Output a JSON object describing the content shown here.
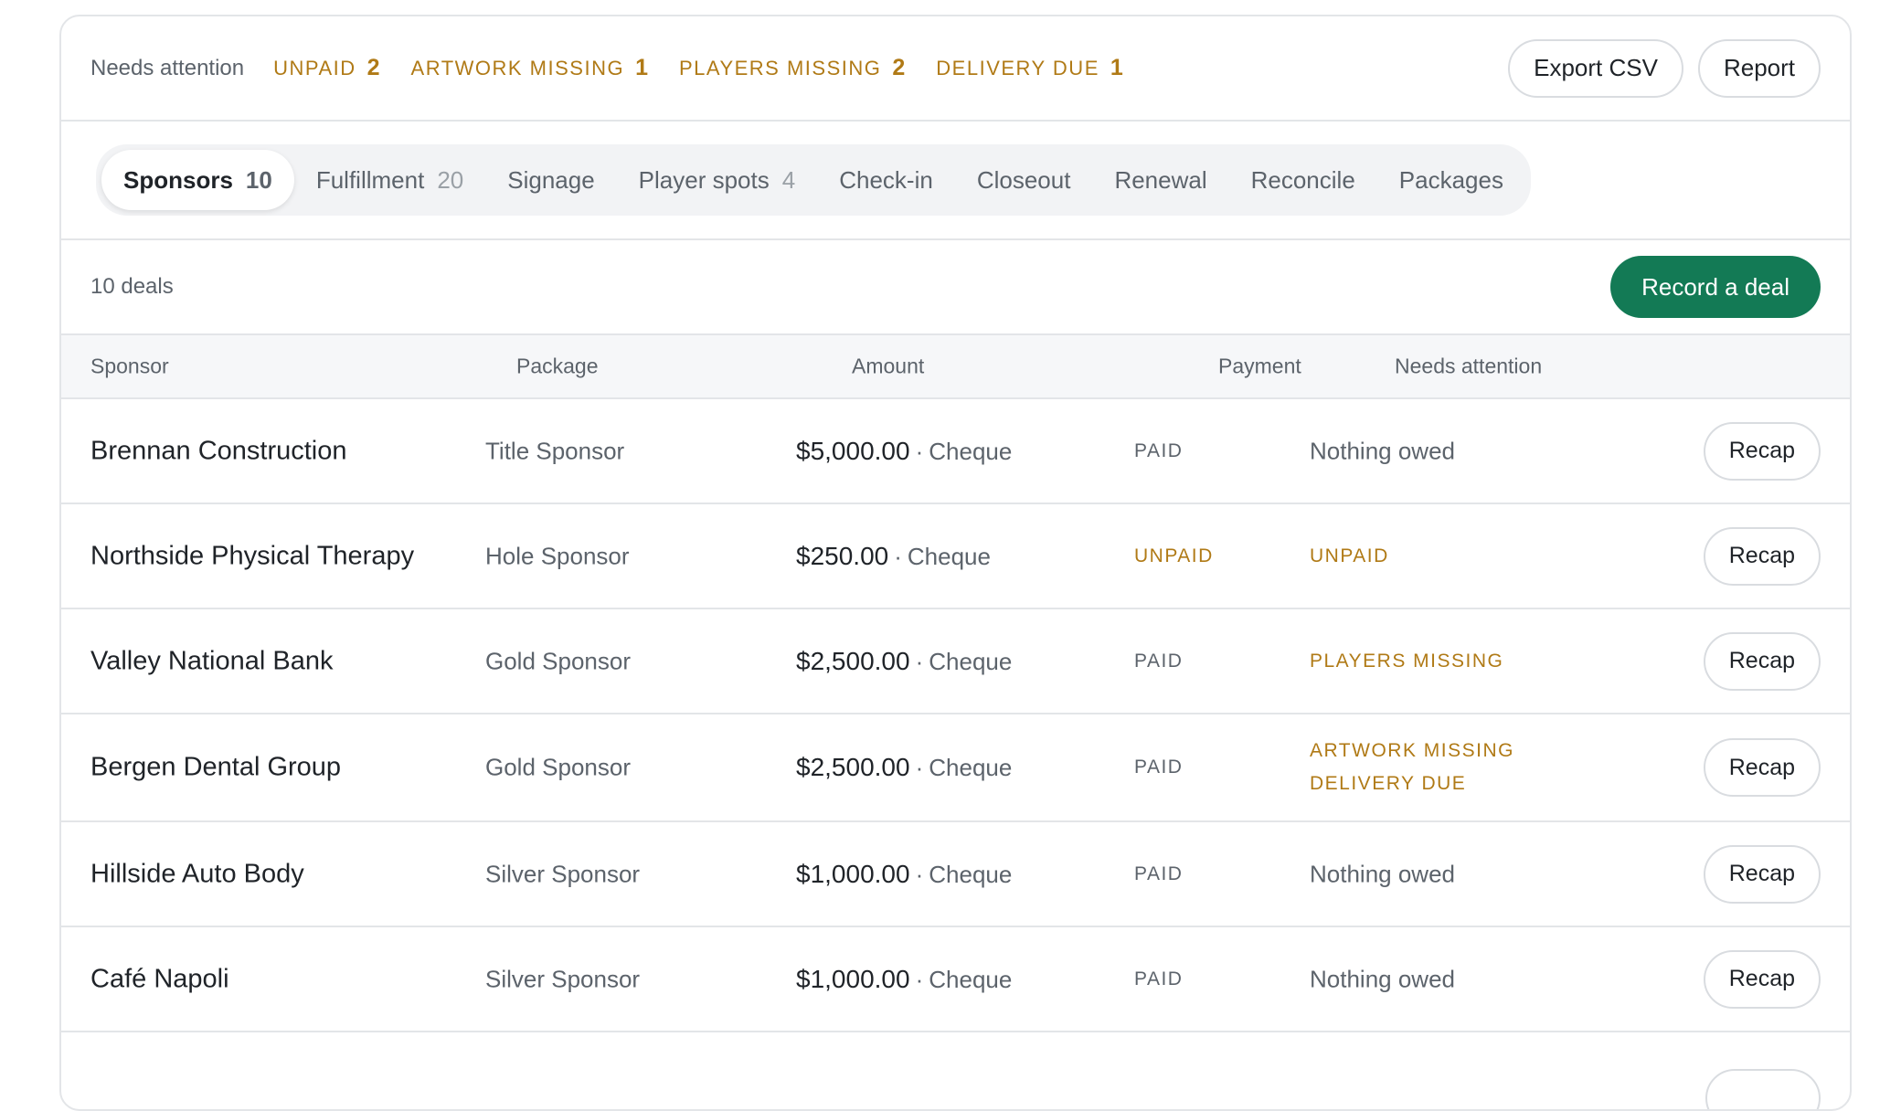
{
  "attention": {
    "label": "Needs attention",
    "filters": [
      {
        "label": "UNPAID",
        "count": "2"
      },
      {
        "label": "ARTWORK MISSING",
        "count": "1"
      },
      {
        "label": "PLAYERS MISSING",
        "count": "2"
      },
      {
        "label": "DELIVERY DUE",
        "count": "1"
      }
    ],
    "export_label": "Export CSV",
    "report_label": "Report"
  },
  "tabs": [
    {
      "label": "Sponsors",
      "count": "10",
      "active": true
    },
    {
      "label": "Fulfillment",
      "count": "20"
    },
    {
      "label": "Signage",
      "count": ""
    },
    {
      "label": "Player spots",
      "count": "4"
    },
    {
      "label": "Check-in",
      "count": ""
    },
    {
      "label": "Closeout",
      "count": ""
    },
    {
      "label": "Renewal",
      "count": ""
    },
    {
      "label": "Reconcile",
      "count": ""
    },
    {
      "label": "Packages",
      "count": ""
    }
  ],
  "deals": {
    "count_label": "10 deals",
    "record_label": "Record a deal"
  },
  "table": {
    "headers": {
      "sponsor": "Sponsor",
      "package": "Package",
      "amount": "Amount",
      "payment": "Payment",
      "attention": "Needs attention"
    },
    "separator": "·",
    "rows": [
      {
        "sponsor": "Brennan Construction",
        "package": "Title Sponsor",
        "amount": "$5,000.00",
        "method": "Cheque",
        "payment": "PAID",
        "attention": "Nothing owed",
        "flags": [],
        "action": "Recap"
      },
      {
        "sponsor": "Northside Physical Therapy",
        "package": "Hole Sponsor",
        "amount": "$250.00",
        "method": "Cheque",
        "payment": "UNPAID",
        "attention": "",
        "flags": [
          "UNPAID"
        ],
        "action": "Recap"
      },
      {
        "sponsor": "Valley National Bank",
        "package": "Gold Sponsor",
        "amount": "$2,500.00",
        "method": "Cheque",
        "payment": "PAID",
        "attention": "",
        "flags": [
          "PLAYERS MISSING"
        ],
        "action": "Recap"
      },
      {
        "sponsor": "Bergen Dental Group",
        "package": "Gold Sponsor",
        "amount": "$2,500.00",
        "method": "Cheque",
        "payment": "PAID",
        "attention": "",
        "flags": [
          "ARTWORK MISSING",
          "DELIVERY DUE"
        ],
        "action": "Recap"
      },
      {
        "sponsor": "Hillside Auto Body",
        "package": "Silver Sponsor",
        "amount": "$1,000.00",
        "method": "Cheque",
        "payment": "PAID",
        "attention": "Nothing owed",
        "flags": [],
        "action": "Recap"
      },
      {
        "sponsor": "Café Napoli",
        "package": "Silver Sponsor",
        "amount": "$1,000.00",
        "method": "Cheque",
        "payment": "PAID",
        "attention": "Nothing owed",
        "flags": [],
        "action": "Recap"
      },
      {
        "sponsor": "",
        "package": "",
        "amount": "",
        "method": "",
        "payment": "",
        "attention": "",
        "flags": [],
        "action": ""
      }
    ]
  }
}
